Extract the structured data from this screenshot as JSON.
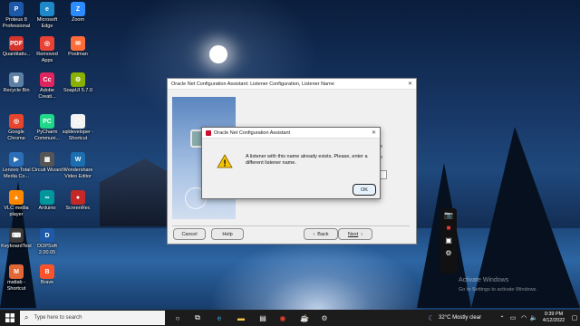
{
  "desktop": {
    "icons": [
      {
        "label": "Proteus 8 Professional",
        "glyph": "P",
        "color": "#1d59a8"
      },
      {
        "label": "Microsoft Edge",
        "glyph": "e",
        "color": "#1e88c9"
      },
      {
        "label": "Zoom",
        "glyph": "Z",
        "color": "#2d8cff"
      },
      {
        "label": "Quantitativ...",
        "glyph": "PDF",
        "color": "#d5342d"
      },
      {
        "label": "Removed Apps",
        "glyph": "◎",
        "color": "#ea4335"
      },
      {
        "label": "Postman",
        "glyph": "✉",
        "color": "#ff6c37"
      },
      {
        "label": "Recycle Bin",
        "glyph": "🗑",
        "color": "#5c7fa3"
      },
      {
        "label": "Adobe Creati...",
        "glyph": "Cc",
        "color": "#e0245e"
      },
      {
        "label": "SoapUI 5.7.0",
        "glyph": "⚙",
        "color": "#8ab000"
      },
      {
        "label": "Google Chrome",
        "glyph": "◎",
        "color": "#e7442d"
      },
      {
        "label": "PyCharm Communi...",
        "glyph": "PC",
        "color": "#21d789"
      },
      {
        "label": "sqldeveloper - Shortcut",
        "glyph": "▢",
        "color": "#f3f3f3"
      },
      {
        "label": "Lenovo Total Media Co...",
        "glyph": "▶",
        "color": "#2b6fb8"
      },
      {
        "label": "Circuit Wizard",
        "glyph": "▦",
        "color": "#555"
      },
      {
        "label": "Wondershare Video Editor",
        "glyph": "W",
        "color": "#1b6fb0"
      },
      {
        "label": "VLC media player",
        "glyph": "▲",
        "color": "#ff8800"
      },
      {
        "label": "Arduino",
        "glyph": "∞",
        "color": "#00979c"
      },
      {
        "label": "ScreenRec",
        "glyph": "●",
        "color": "#c62828"
      },
      {
        "label": "KeyboardTest",
        "glyph": "⌨",
        "color": "#3b3b3b"
      },
      {
        "label": "DOPSoft 2.00.05",
        "glyph": "D",
        "color": "#1e5aa8"
      },
      {
        "label": "matlab - Shortcut",
        "glyph": "M",
        "color": "#e16737"
      },
      {
        "label": "Brave",
        "glyph": "B",
        "color": "#fb542b"
      }
    ]
  },
  "main_window": {
    "title": "Oracle Net Configuration Assistant: Listener Configuration, Listener Name",
    "buttons": {
      "cancel": "Cancel",
      "help": "Help",
      "back": "Back",
      "next": "Next"
    }
  },
  "dialog": {
    "title": "Oracle Net Configuration Assistant",
    "message": "A listener with this name already exists. Please, enter a different listener name.",
    "ok": "OK"
  },
  "watermark": {
    "line1": "Activate Windows",
    "line2": "Go to Settings to activate Windows."
  },
  "taskbar": {
    "search_placeholder": "Type here to search",
    "weather": "32°C  Mostly clear",
    "time": "9:39 PM",
    "date": "4/12/2022"
  }
}
